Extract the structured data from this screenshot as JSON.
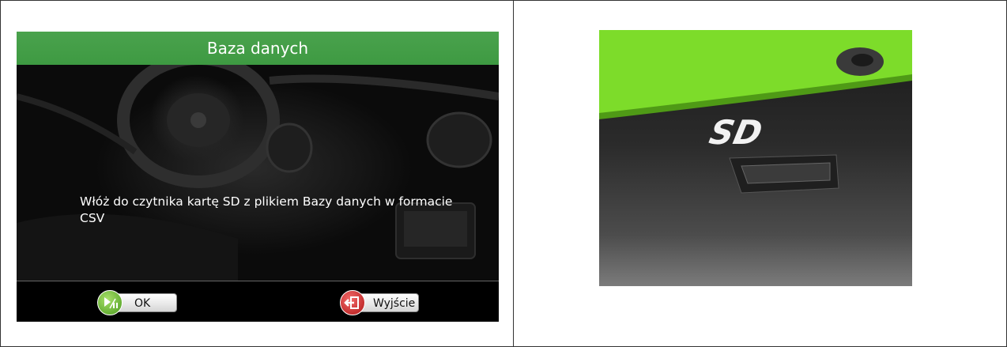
{
  "screen": {
    "title": "Baza danych",
    "message": "Włóż do czytnika kartę SD z plikiem Bazy danych w formacie CSV",
    "ok_label": "OK",
    "exit_label": "Wyjście"
  },
  "photo": {
    "sd_label": "SD"
  },
  "colors": {
    "title_bar": "#43a047",
    "device_green": "#7ddc2a",
    "ok_icon": "#5cb82a",
    "exit_icon": "#d32020"
  },
  "icons": {
    "ok": "play-pause-icon",
    "exit": "exit-door-icon"
  }
}
